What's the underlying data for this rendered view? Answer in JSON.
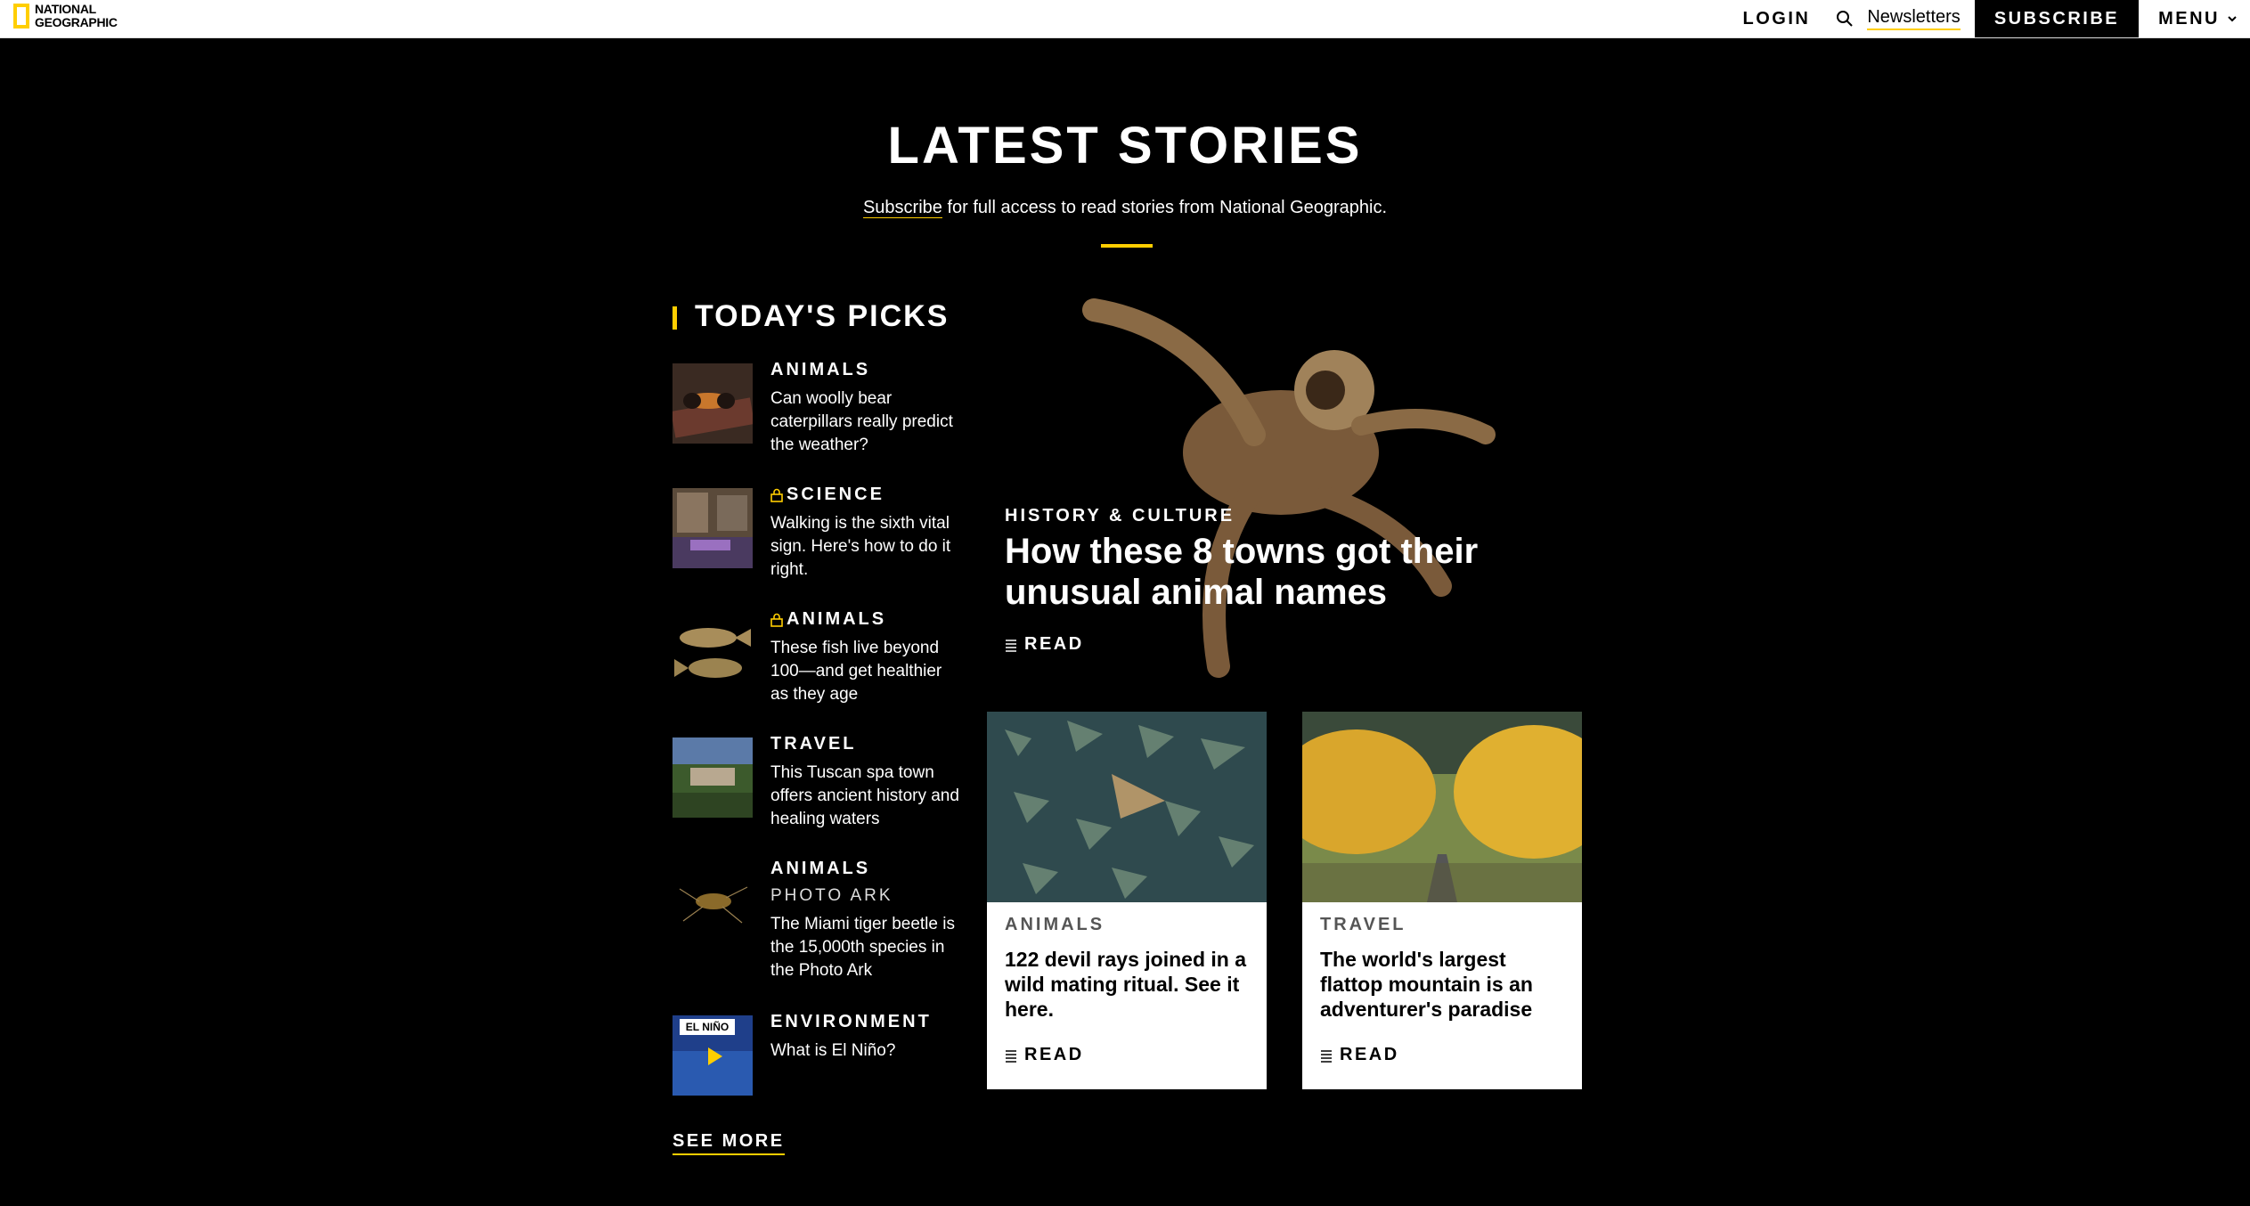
{
  "brand": {
    "logo_line1": "NATIONAL",
    "logo_line2": "GEOGRAPHIC",
    "accent": "#ffce00",
    "background": "#000000"
  },
  "nav": {
    "login": "LOGIN",
    "search_icon": "search-icon",
    "newsletters": "Newsletters",
    "subscribe": "SUBSCRIBE",
    "menu": "MENU"
  },
  "header": {
    "title": "LATEST STORIES",
    "subscribe_link": "Subscribe",
    "subtitle_rest": " for full access to read stories from National Geographic."
  },
  "picks": {
    "heading": "TODAY'S PICKS",
    "items": [
      {
        "category": "ANIMALS",
        "locked": false,
        "subcategory": "",
        "headline": "Can woolly bear caterpillars really predict the weather?"
      },
      {
        "category": "SCIENCE",
        "locked": true,
        "subcategory": "",
        "headline": "Walking is the sixth vital sign. Here's how to do it right."
      },
      {
        "category": "ANIMALS",
        "locked": true,
        "subcategory": "",
        "headline": "These fish live beyond 100—and get healthier as they age"
      },
      {
        "category": "TRAVEL",
        "locked": false,
        "subcategory": "",
        "headline": "This Tuscan spa town offers ancient history and healing waters"
      },
      {
        "category": "ANIMALS",
        "locked": false,
        "subcategory": "PHOTO ARK",
        "headline": "The Miami tiger beetle is the 15,000th species in the Photo Ark"
      },
      {
        "category": "ENVIRONMENT",
        "locked": false,
        "subcategory": "",
        "headline": "What is El Niño?",
        "thumb_badge": "EL NIÑO"
      }
    ],
    "see_more": "SEE MORE"
  },
  "hero": {
    "category": "HISTORY & CULTURE",
    "title": "How these 8 towns got their unusual animal names",
    "read": "READ"
  },
  "cards": [
    {
      "category": "ANIMALS",
      "title": "122 devil rays joined in a wild mating ritual. See it here.",
      "read": "READ"
    },
    {
      "category": "TRAVEL",
      "title": "The world's largest flattop mountain is an adventurer's paradise",
      "read": "READ"
    }
  ]
}
